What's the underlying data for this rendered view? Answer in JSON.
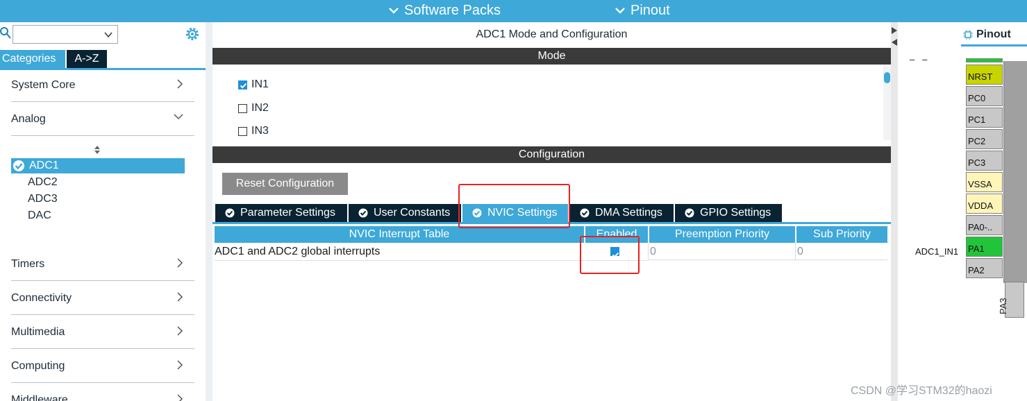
{
  "menu": {
    "software_packs": "Software Packs",
    "pinout": "Pinout"
  },
  "left": {
    "tabs": {
      "categories": "Categories",
      "az": "A->Z"
    },
    "categories": [
      {
        "label": "System Core",
        "expanded": false
      },
      {
        "label": "Analog",
        "expanded": true
      },
      {
        "label": "Timers",
        "expanded": false
      },
      {
        "label": "Connectivity",
        "expanded": false
      },
      {
        "label": "Multimedia",
        "expanded": false
      },
      {
        "label": "Computing",
        "expanded": false
      },
      {
        "label": "Middleware",
        "expanded": false
      }
    ],
    "analog_items": [
      "ADC1",
      "ADC2",
      "ADC3",
      "DAC"
    ],
    "selected_item": "ADC1"
  },
  "center": {
    "title": "ADC1 Mode and Configuration",
    "mode_header": "Mode",
    "mode_items": [
      {
        "label": "IN1",
        "checked": true
      },
      {
        "label": "IN2",
        "checked": false
      },
      {
        "label": "IN3",
        "checked": false
      }
    ],
    "config_header": "Configuration",
    "reset_label": "Reset Configuration",
    "tabs": [
      "Parameter Settings",
      "User Constants",
      "NVIC Settings",
      "DMA Settings",
      "GPIO Settings"
    ],
    "active_tab": "NVIC Settings",
    "table": {
      "headers": [
        "NVIC Interrupt Table",
        "Enabled",
        "Preemption Priority",
        "Sub Priority"
      ],
      "rows": [
        {
          "name": "ADC1 and ADC2 global interrupts",
          "enabled": true,
          "preemption": "0",
          "sub": "0"
        }
      ]
    }
  },
  "right": {
    "tab": "Pinout",
    "dashes": "–   –",
    "pins": [
      {
        "label": "NRST",
        "color": "#c8d400"
      },
      {
        "label": "PC0",
        "color": "#c8c8c8"
      },
      {
        "label": "PC1",
        "color": "#c8c8c8"
      },
      {
        "label": "PC2",
        "color": "#c8c8c8"
      },
      {
        "label": "PC3",
        "color": "#c8c8c8"
      },
      {
        "label": "VSSA",
        "color": "#fff5b8"
      },
      {
        "label": "VDDA",
        "color": "#fff5b8"
      },
      {
        "label": "PA0-..",
        "color": "#c8c8c8"
      },
      {
        "label": "PA1",
        "color": "#22c53a"
      },
      {
        "label": "PA2",
        "color": "#c8c8c8"
      }
    ],
    "bottom_pin": "PA3",
    "signal_label": "ADC1_IN1"
  },
  "watermark": "CSDN @学习STM32的haozi"
}
